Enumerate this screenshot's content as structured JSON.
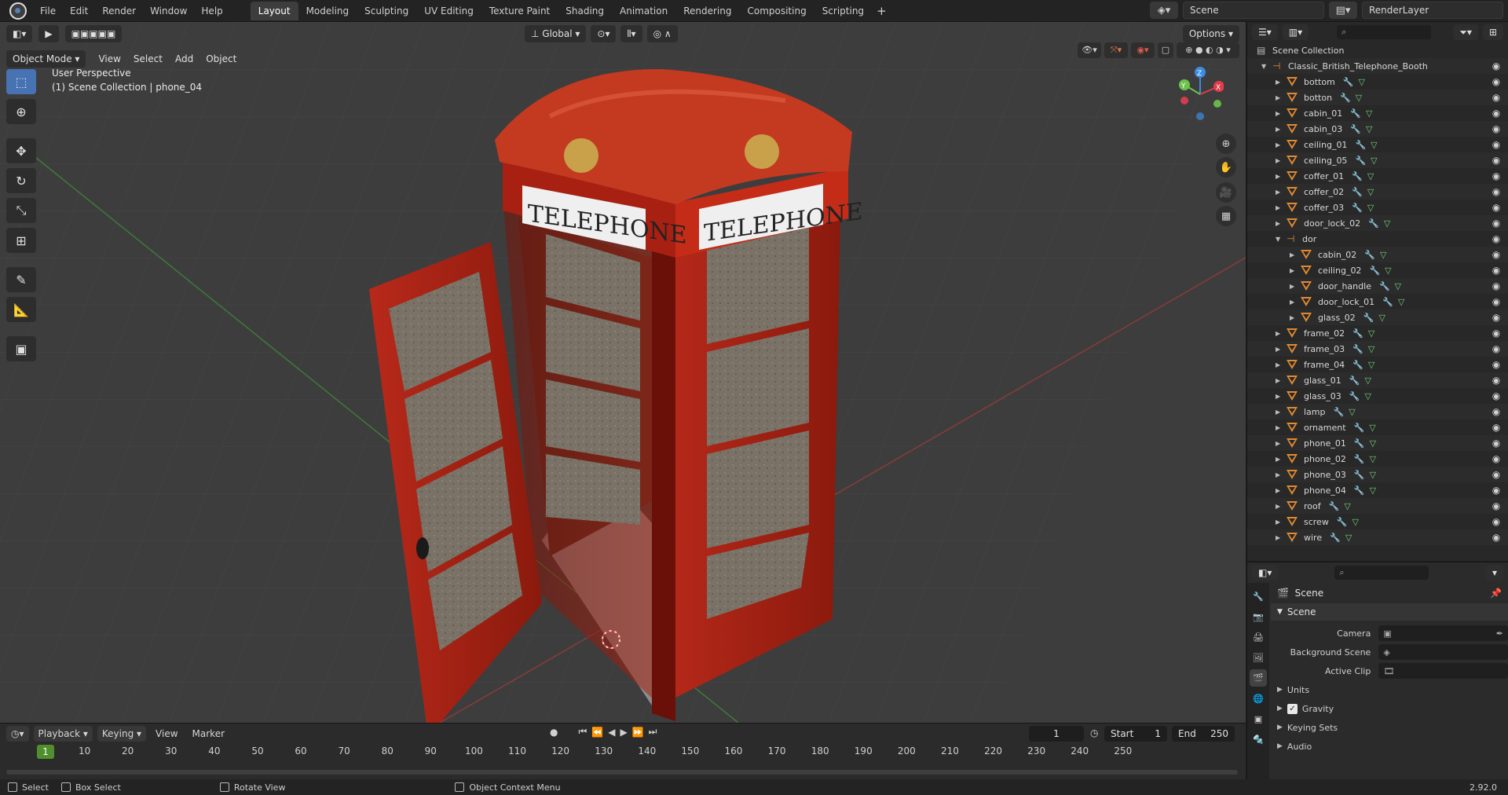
{
  "topbar": {
    "menu": [
      "File",
      "Edit",
      "Render",
      "Window",
      "Help"
    ],
    "workspaces": [
      "Layout",
      "Modeling",
      "Sculpting",
      "UV Editing",
      "Texture Paint",
      "Shading",
      "Animation",
      "Rendering",
      "Compositing",
      "Scripting"
    ],
    "active_workspace": "Layout",
    "scene": "Scene",
    "render_layer": "RenderLayer"
  },
  "viewport": {
    "mode": "Object Mode",
    "menus": [
      "View",
      "Select",
      "Add",
      "Object"
    ],
    "transform_orientation": "Global",
    "options_label": "Options",
    "perspective_text": "User Perspective",
    "collection_text": "(1) Scene Collection | phone_04",
    "booth_sign_left": "TELEPHONE",
    "booth_sign_right": "TELEPHONE",
    "gizmo_axes": {
      "z": "Z",
      "y": "Y",
      "x": "X"
    },
    "axis_colors": {
      "x": "#e23c4c",
      "y": "#6bc24c",
      "z": "#3c8ce2"
    }
  },
  "timeline": {
    "menus": [
      "Playback",
      "Keying",
      "View",
      "Marker"
    ],
    "current_frame": "1",
    "start_label": "Start",
    "start": "1",
    "end_label": "End",
    "end": "250",
    "ticks": [
      "10",
      "20",
      "30",
      "40",
      "50",
      "60",
      "70",
      "80",
      "90",
      "100",
      "110",
      "120",
      "130",
      "140",
      "150",
      "160",
      "170",
      "180",
      "190",
      "200",
      "210",
      "220",
      "230",
      "240",
      "250"
    ]
  },
  "statusbar": {
    "select": "Select",
    "box_select": "Box Select",
    "rotate_view": "Rotate View",
    "context_menu": "Object Context Menu",
    "version": "2.92.0"
  },
  "outliner": {
    "root": "Scene Collection",
    "collection": "Classic_British_Telephone_Booth",
    "items": [
      {
        "name": "bottom",
        "level": 1,
        "type": "mesh"
      },
      {
        "name": "botton",
        "level": 1,
        "type": "mesh"
      },
      {
        "name": "cabin_01",
        "level": 1,
        "type": "mesh"
      },
      {
        "name": "cabin_03",
        "level": 1,
        "type": "mesh"
      },
      {
        "name": "ceiling_01",
        "level": 1,
        "type": "mesh"
      },
      {
        "name": "ceiling_05",
        "level": 1,
        "type": "mesh"
      },
      {
        "name": "coffer_01",
        "level": 1,
        "type": "mesh"
      },
      {
        "name": "coffer_02",
        "level": 1,
        "type": "mesh"
      },
      {
        "name": "coffer_03",
        "level": 1,
        "type": "mesh"
      },
      {
        "name": "door_lock_02",
        "level": 1,
        "type": "mesh"
      },
      {
        "name": "dor",
        "level": 1,
        "type": "empty"
      },
      {
        "name": "cabin_02",
        "level": 2,
        "type": "mesh"
      },
      {
        "name": "ceiling_02",
        "level": 2,
        "type": "mesh"
      },
      {
        "name": "door_handle",
        "level": 2,
        "type": "mesh"
      },
      {
        "name": "door_lock_01",
        "level": 2,
        "type": "mesh"
      },
      {
        "name": "glass_02",
        "level": 2,
        "type": "mesh"
      },
      {
        "name": "frame_02",
        "level": 1,
        "type": "mesh"
      },
      {
        "name": "frame_03",
        "level": 1,
        "type": "mesh"
      },
      {
        "name": "frame_04",
        "level": 1,
        "type": "mesh"
      },
      {
        "name": "glass_01",
        "level": 1,
        "type": "mesh"
      },
      {
        "name": "glass_03",
        "level": 1,
        "type": "mesh"
      },
      {
        "name": "lamp",
        "level": 1,
        "type": "mesh"
      },
      {
        "name": "ornament",
        "level": 1,
        "type": "mesh"
      },
      {
        "name": "phone_01",
        "level": 1,
        "type": "mesh"
      },
      {
        "name": "phone_02",
        "level": 1,
        "type": "mesh"
      },
      {
        "name": "phone_03",
        "level": 1,
        "type": "mesh"
      },
      {
        "name": "phone_04",
        "level": 1,
        "type": "mesh"
      },
      {
        "name": "roof",
        "level": 1,
        "type": "mesh"
      },
      {
        "name": "screw",
        "level": 1,
        "type": "mesh"
      },
      {
        "name": "wire",
        "level": 1,
        "type": "mesh"
      }
    ]
  },
  "properties": {
    "title": "Scene",
    "panel": "Scene",
    "camera_label": "Camera",
    "background_scene_label": "Background Scene",
    "active_clip_label": "Active Clip",
    "units_label": "Units",
    "gravity_label": "Gravity",
    "keying_sets_label": "Keying Sets",
    "audio_label": "Audio"
  }
}
